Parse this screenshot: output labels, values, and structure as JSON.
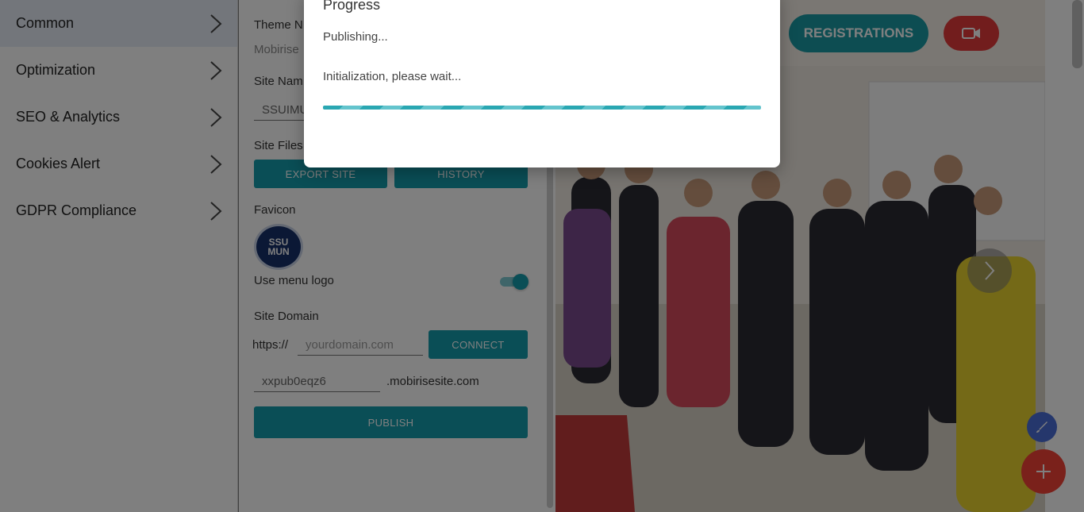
{
  "menu": {
    "items": [
      {
        "label": "Common",
        "active": true
      },
      {
        "label": "Optimization",
        "active": false
      },
      {
        "label": "SEO & Analytics",
        "active": false
      },
      {
        "label": "Cookies Alert",
        "active": false
      },
      {
        "label": "GDPR Compliance",
        "active": false
      }
    ]
  },
  "panel": {
    "theme_name_label": "Theme N",
    "theme_name_value": "Mobirise",
    "site_name_label": "Site Nam",
    "site_name_value": "SSUIMU",
    "site_files_label": "Site Files",
    "export_label": "EXPORT SITE",
    "history_label": "HISTORY",
    "favicon_label": "Favicon",
    "favicon_text_line1": "SSU",
    "favicon_text_line2": "MUN",
    "use_menu_logo_label": "Use menu logo",
    "use_menu_logo_on": true,
    "site_domain_label": "Site Domain",
    "domain_prefix": "https://",
    "domain_placeholder": "yourdomain.com",
    "connect_label": "CONNECT",
    "subdomain_value": "xxpub0eqz6",
    "subdomain_suffix": ".mobirisesite.com",
    "publish_label": "PUBLISH"
  },
  "preview": {
    "registrations_label": "REGISTRATIONS",
    "video_icon": "video-camera-icon",
    "slider_icon": "chevron-right-icon"
  },
  "modal": {
    "title": "Progress",
    "status": "Publishing...",
    "detail": "Initialization, please wait...",
    "progress_fraction": 1.0
  },
  "fabs": {
    "edit_icon": "brush-icon",
    "add_icon": "plus-icon"
  },
  "colors": {
    "accent": "#149dad",
    "registrations": "#1a9aa4",
    "video_button": "#e43a3a",
    "fab_add": "#f44336",
    "fab_edit": "#4a6fd9"
  }
}
